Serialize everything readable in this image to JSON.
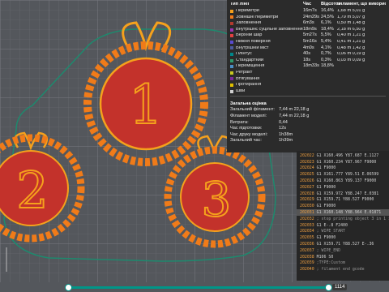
{
  "app": {
    "theme_accent": "#009688"
  },
  "legend": {
    "headers": {
      "type": "Тип лінії",
      "time": "Час",
      "percent": "Відсоток",
      "filament": "Філамент, що використано"
    },
    "rows": [
      {
        "name": "Периметри",
        "time": "16m7s",
        "percent": "16,4%",
        "filament": "1,68 m    5,01 g",
        "color": "#f5a11c"
      },
      {
        "name": "Зовнішні периметри",
        "time": "24m29s",
        "percent": "24,5%",
        "filament": "1,79 m    5,07 g",
        "color": "#f07b19"
      },
      {
        "name": "Заповнення",
        "time": "6m3s",
        "percent": "6,1%",
        "filament": "0,50 m    1,48 g",
        "color": "#b33a2e"
      },
      {
        "name": "Внутрішнє суцільне заповнення",
        "time": "18m9s",
        "percent": "18,4%",
        "filament": "2,18 m    6,50 g",
        "color": "#9c35b3"
      },
      {
        "name": "Верхній шар",
        "time": "5m27s",
        "percent": "5,5%",
        "filament": "0,40 m    1,21 g",
        "color": "#e34141"
      },
      {
        "name": "Нижня поверхня",
        "time": "5m16s",
        "percent": "5,4%",
        "filament": "0,41 m    1,21 g",
        "color": "#5a4bd1"
      },
      {
        "name": "Внутрішній міст",
        "time": "4m0s",
        "percent": "4,1%",
        "filament": "0,48 m    1,42 g",
        "color": "#4d5b9e"
      },
      {
        "name": "Плінтус",
        "time": "40s",
        "percent": "0,7%",
        "filament": "0,06 m    0,19 g",
        "color": "#00878a"
      },
      {
        "name": "Стандартний",
        "time": "18s",
        "percent": "0,3%",
        "filament": "0,03 m    0,09 g",
        "color": "#2e9a6b"
      },
      {
        "name": "Переміщення",
        "time": "18m33s",
        "percent": "18,8%",
        "filament": "",
        "color": "#4c8fc4"
      },
      {
        "name": "Ретракт",
        "time": "",
        "percent": "",
        "filament": "",
        "color": "#c8c820"
      },
      {
        "name": "Втягування",
        "time": "",
        "percent": "",
        "filament": "",
        "color": "#7a2a9c"
      },
      {
        "name": "Протирання",
        "time": "",
        "percent": "",
        "filament": "",
        "color": "#e0c000"
      },
      {
        "name": "Шви",
        "time": "",
        "percent": "",
        "filament": "",
        "color": "#d0d0d0"
      }
    ],
    "summary_title": "Загальна оцінка",
    "summary": [
      {
        "k": "Загальний філамент:",
        "v": "7,44 m        22,18 g"
      },
      {
        "k": "Філамент моделі:",
        "v": "7,44 m        22,18 g"
      },
      {
        "k": "Витрата:",
        "v": "0,44"
      },
      {
        "k": "Час підготовки:",
        "v": "12s"
      },
      {
        "k": "Час друку моделі:",
        "v": "1h38m"
      },
      {
        "k": "Загальний час:",
        "v": "1h39m"
      }
    ]
  },
  "gcode": {
    "lines": [
      {
        "n": "202022",
        "c": "G1 X160.496 Y87.687 E.1127"
      },
      {
        "n": "202023",
        "c": "G1 X160.234 Y87.967 F9000"
      },
      {
        "n": "202024",
        "c": "G1 F9000"
      },
      {
        "n": "202025",
        "c": "G1 X161.777 Y89.51 E.06599"
      },
      {
        "n": "202026",
        "c": "G1 X160.863 Y89.137 F9000"
      },
      {
        "n": "202027",
        "c": "G1 F9000"
      },
      {
        "n": "202028",
        "c": "G1 X159.972 Y88.247 E.0381"
      },
      {
        "n": "202029",
        "c": "G1 X159.71 Y88.527 F9000"
      },
      {
        "n": "202030",
        "c": "G1 F9000"
      },
      {
        "n": "202031",
        "c": "G1 X160.148 Y88.964 E.01871",
        "hl": true
      },
      {
        "n": "202032",
        "c": "; stop printing object 3 in 1 id at 14673",
        "cm": true
      },
      {
        "n": "202033",
        "c": "G1 E-.8 F2400"
      },
      {
        "n": "202034",
        "c": "; WIPE_START",
        "cm": true
      },
      {
        "n": "202035",
        "c": "G1 F9000"
      },
      {
        "n": "202036",
        "c": "G1 X159.71 Y88.527 E-.36"
      },
      {
        "n": "202037",
        "c": "; WIPE_END",
        "cm": true
      },
      {
        "n": "202038",
        "c": "M106 S0"
      },
      {
        "n": "202039",
        "c": ";TYPE:Custom",
        "cm": true
      },
      {
        "n": "202040",
        "c": "; filament end gcode",
        "cm": true
      }
    ]
  },
  "slider": {
    "value_label": "1114",
    "fraction": 1.0
  }
}
